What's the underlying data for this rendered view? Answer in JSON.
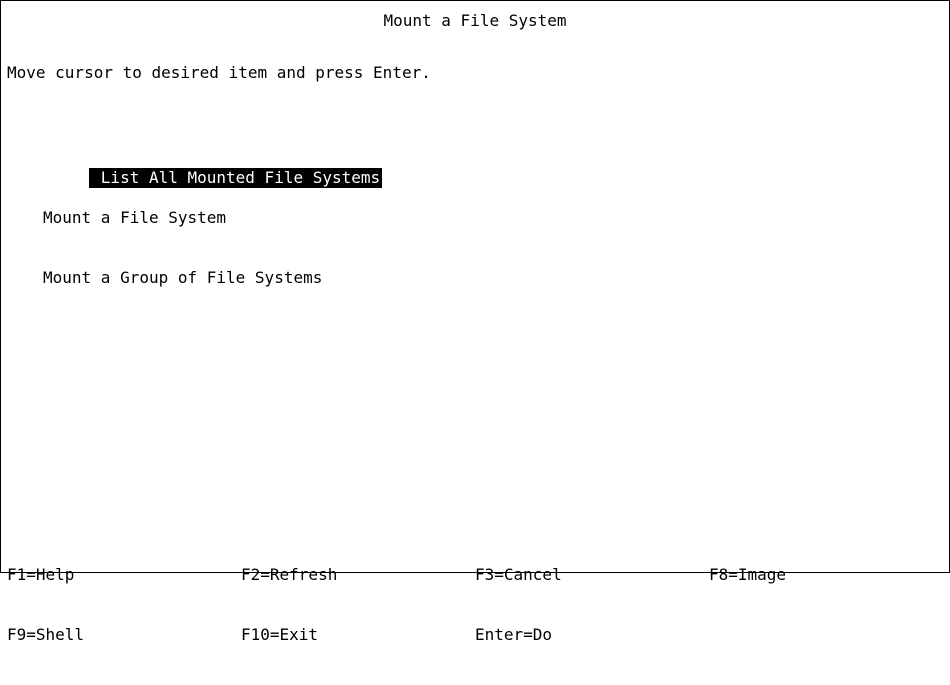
{
  "title": "Mount a File System",
  "instructions": "Move cursor to desired item and press Enter.",
  "menu": {
    "items": [
      {
        "label": "List All Mounted File Systems",
        "selected": true
      },
      {
        "label": "Mount a File System",
        "selected": false
      },
      {
        "label": "Mount a Group of File Systems",
        "selected": false
      }
    ]
  },
  "function_keys": {
    "row1": [
      "F1=Help",
      "F2=Refresh",
      "F3=Cancel",
      "F8=Image"
    ],
    "row2": [
      "F9=Shell",
      "F10=Exit",
      "Enter=Do"
    ]
  },
  "colors": {
    "background": "#ffffff",
    "foreground": "#000000",
    "selection_background": "#000000",
    "selection_foreground": "#ffffff"
  }
}
